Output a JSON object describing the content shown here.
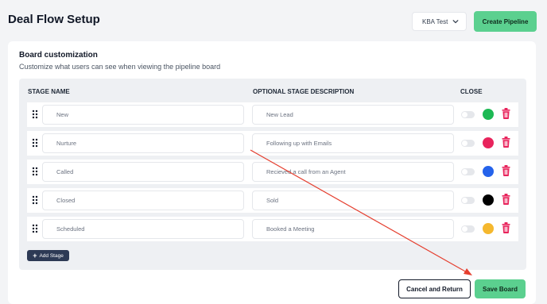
{
  "header": {
    "title": "Deal Flow Setup",
    "board_select": "KBA Test",
    "create_label": "Create Pipeline"
  },
  "card": {
    "title": "Board customization",
    "subtitle": "Customize what users can see when viewing the pipeline board",
    "columns": {
      "name": "STAGE NAME",
      "description": "OPTIONAL STAGE DESCRIPTION",
      "close": "CLOSE"
    }
  },
  "stages": [
    {
      "name": "New",
      "description": "New Lead",
      "color": "#1db954",
      "close": false
    },
    {
      "name": "Nurture",
      "description": "Following up with Emails",
      "color": "#e8245c",
      "close": false
    },
    {
      "name": "Called",
      "description": "Recieved a call from an Agent",
      "color": "#2563eb",
      "close": false
    },
    {
      "name": "Closed",
      "description": "Sold",
      "color": "#000000",
      "close": false
    },
    {
      "name": "Scheduled",
      "description": "Booked a Meeting",
      "color": "#f5b82e",
      "close": false
    }
  ],
  "actions": {
    "add_stage": "Add Stage",
    "cancel": "Cancel and Return",
    "save": "Save Board"
  },
  "colors": {
    "accent_green": "#5bd08f",
    "trash_red": "#e8245c",
    "add_button": "#2d3a55",
    "annotation_arrow": "#e53e2e"
  }
}
